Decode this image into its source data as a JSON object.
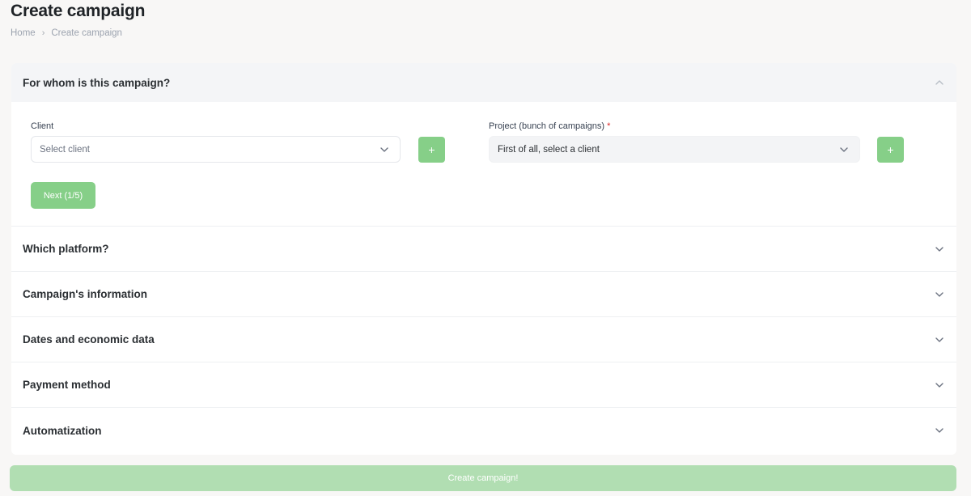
{
  "page": {
    "title": "Create campaign",
    "breadcrumb": {
      "home": "Home",
      "separator": "›",
      "current": "Create campaign"
    }
  },
  "sections": {
    "audience": {
      "title": "For whom is this campaign?",
      "client_label": "Client",
      "client_placeholder": "Select client",
      "project_label": "Project (bunch of campaigns)",
      "project_required_mark": "*",
      "project_placeholder": "First of all, select a client",
      "add_label": "+",
      "next_label": "Next (1/5)"
    },
    "platform": {
      "title": "Which platform?"
    },
    "information": {
      "title": "Campaign's information"
    },
    "dates": {
      "title": "Dates and economic data"
    },
    "payment": {
      "title": "Payment method"
    },
    "automation": {
      "title": "Automatization"
    }
  },
  "footer": {
    "create_label": "Create campaign!"
  },
  "colors": {
    "accent": "#86cf88",
    "accent_light": "#b1deb2",
    "required": "#dc2626"
  },
  "icons": {
    "expanded": "chevron-up-icon",
    "collapsed": "chevron-down-icon",
    "select": "chevron-down-icon"
  }
}
